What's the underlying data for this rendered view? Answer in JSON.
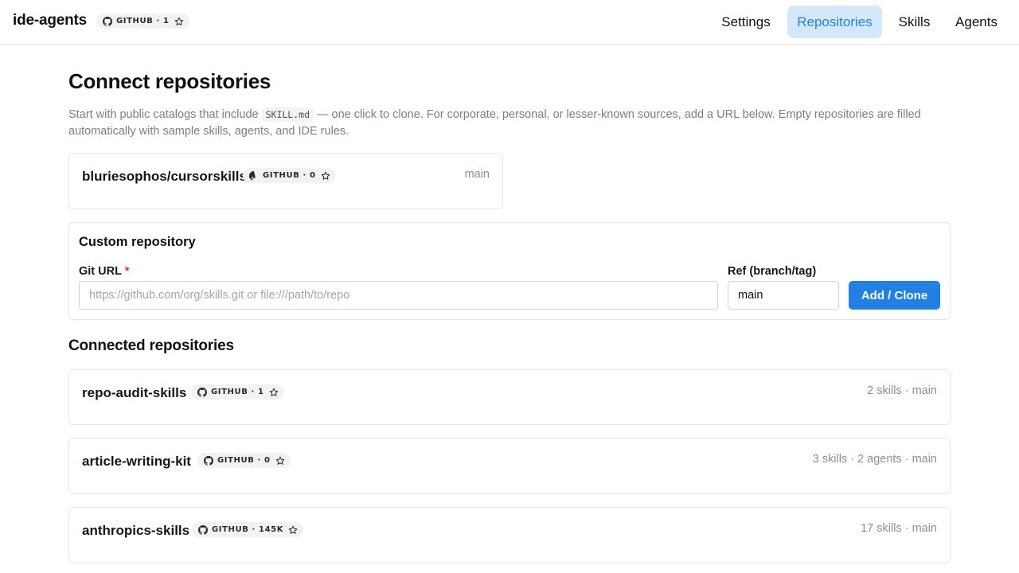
{
  "app": {
    "brand": "ide-agents",
    "badge": "GITHUB · 1"
  },
  "nav": {
    "items": [
      {
        "label": "Settings",
        "active": false
      },
      {
        "label": "Repositories",
        "active": true
      },
      {
        "label": "Skills",
        "active": false
      },
      {
        "label": "Agents",
        "active": false
      }
    ]
  },
  "page": {
    "title": "Connect repositories",
    "intro_before": "Start with public catalogs that include ",
    "intro_code": "SKILL.md",
    "intro_after": " — one click to clone. For corporate, personal, or lesser-known sources, add a URL below. Empty repositories are filled automatically with sample skills, agents, and IDE rules."
  },
  "catalog": [
    {
      "name": "bluriesophos/cursorskills",
      "badge": "GITHUB · 0",
      "meta": "main"
    }
  ],
  "custom": {
    "title": "Custom repository",
    "git_url_label": "Git URL",
    "required_mark": "*",
    "git_url_value": "",
    "git_url_placeholder": "https://github.com/org/skills.git or file:///path/to/repo",
    "ref_label": "Ref (branch/tag)",
    "ref_value": "main",
    "submit_label": "Add / Clone"
  },
  "connected": {
    "title": "Connected repositories",
    "items": [
      {
        "name": "repo-audit-skills",
        "badge": "GITHUB · 1",
        "meta": "2 skills · main"
      },
      {
        "name": "article-writing-kit",
        "badge": "GITHUB · 0",
        "meta": "3 skills · 2 agents · main"
      },
      {
        "name": "anthropics-skills",
        "badge": "GITHUB · 145K",
        "meta": "17 skills · main"
      }
    ]
  },
  "colors": {
    "accent": "#2380e3",
    "nav_active_bg": "#d3e8fb",
    "required": "#e03131"
  },
  "icons": [
    "github-icon",
    "star-icon"
  ]
}
